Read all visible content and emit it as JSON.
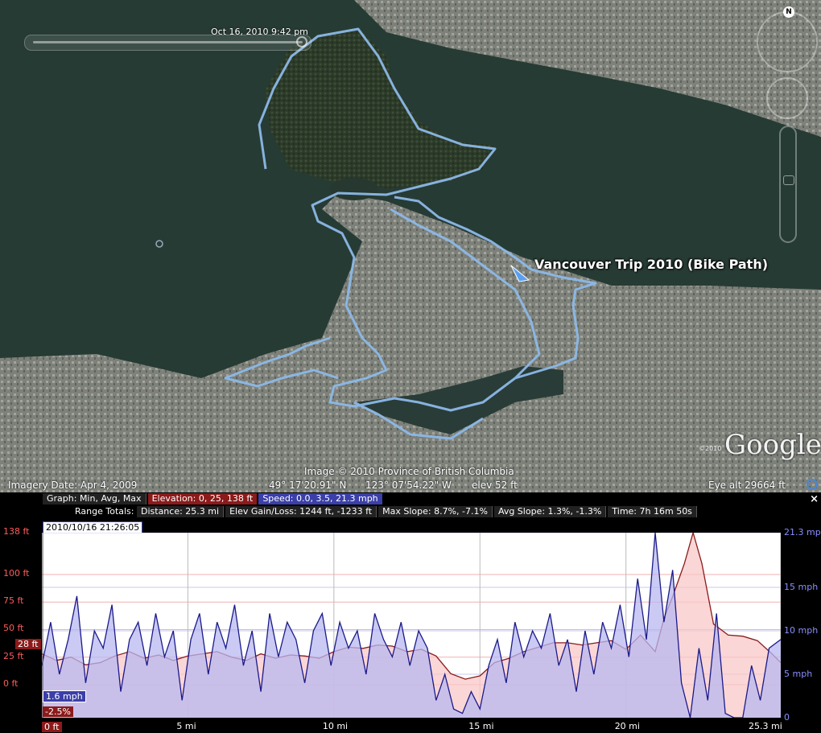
{
  "map": {
    "time_label": "Oct 16, 2010   9:42 pm",
    "placemark_label": "Vancouver Trip 2010 (Bike Path)",
    "attribution": "Image © 2010 Province of British Columbia",
    "logo_text": "Google",
    "logo_copyright": "©2010",
    "compass_label": "N",
    "status": {
      "imagery_date": "Imagery Date: Apr  4, 2009",
      "latitude": "49°  17'20.91\" N",
      "longitude": "123°  07'54.22\" W",
      "elev": "elev    52 ft",
      "eye_alt": "Eye alt    29664 ft"
    },
    "colors": {
      "track": "#8cb8e8",
      "water": "#263a35",
      "land": "#7a7f78"
    }
  },
  "profile": {
    "close_label": "×",
    "graph_label": "Graph: Min, Avg, Max",
    "elevation_stats": "Elevation: 0, 25, 138 ft",
    "speed_stats": "Speed: 0.0, 3.5, 21.3 mph",
    "range_totals_label": "Range Totals:",
    "distance": "Distance: 25.3 mi",
    "elev_gain_loss": "Elev Gain/Loss: 1244 ft, -1233 ft",
    "max_slope": "Max Slope: 8.7%, -7.1%",
    "avg_slope": "Avg Slope: 1.3%, -1.3%",
    "time": "Time: 7h 16m 50s",
    "cursor_date": "2010/10/16 21:26:05",
    "cursor_elev": "28 ft",
    "cursor_speed": "1.6 mph",
    "cursor_slope": "-2.5%",
    "cursor_distance": "0 ft",
    "colors": {
      "elevation": "#8b1a1a",
      "elevation_fill": "#f8c8c8",
      "speed": "#1a1a8a",
      "speed_fill": "#b8b8f0"
    }
  },
  "chart_data": {
    "type": "area",
    "xlabel": "",
    "ylabel_left": "",
    "ylabel_right": "",
    "x_ticks": [
      "5 mi",
      "10 mi",
      "15 mi",
      "20 mi",
      "25.3 mi"
    ],
    "y_left_ticks": [
      "138 ft",
      "100 ft",
      "75 ft",
      "50 ft",
      "25 ft",
      "0 ft"
    ],
    "y_left_tick_values": [
      138,
      100,
      75,
      50,
      25,
      0
    ],
    "y_right_ticks": [
      "21.3 mph",
      "15 mph",
      "10 mph",
      "5 mph",
      "0"
    ],
    "y_right_tick_values": [
      21.3,
      15,
      10,
      5,
      0
    ],
    "xlim": [
      0,
      25.3
    ],
    "ylim_left": [
      -30,
      138
    ],
    "ylim_right": [
      0,
      21.3
    ],
    "series": [
      {
        "name": "Elevation",
        "unit": "ft",
        "x": [
          0,
          0.5,
          1,
          1.5,
          2,
          2.5,
          3,
          3.5,
          4,
          4.5,
          5,
          5.5,
          6,
          6.5,
          7,
          7.5,
          8,
          8.5,
          9,
          9.5,
          10,
          10.5,
          11,
          11.5,
          12,
          12.5,
          13,
          13.5,
          14,
          14.5,
          15,
          15.5,
          16,
          16.5,
          17,
          17.5,
          18,
          18.5,
          19,
          19.5,
          20,
          20.5,
          21,
          21.3,
          21.6,
          22,
          22.3,
          22.6,
          23,
          23.5,
          24,
          24.5,
          25,
          25.3
        ],
        "values": [
          28,
          22,
          25,
          18,
          20,
          26,
          30,
          24,
          27,
          22,
          26,
          28,
          30,
          25,
          22,
          28,
          24,
          27,
          26,
          24,
          30,
          34,
          33,
          36,
          35,
          30,
          32,
          26,
          10,
          5,
          8,
          20,
          24,
          30,
          34,
          38,
          38,
          36,
          38,
          40,
          32,
          45,
          30,
          60,
          80,
          110,
          138,
          110,
          55,
          45,
          44,
          40,
          28,
          20
        ]
      },
      {
        "name": "Speed",
        "unit": "mph",
        "x": [
          0,
          0.3,
          0.6,
          0.9,
          1.2,
          1.5,
          1.8,
          2.1,
          2.4,
          2.7,
          3,
          3.3,
          3.6,
          3.9,
          4.2,
          4.5,
          4.8,
          5.1,
          5.4,
          5.7,
          6,
          6.3,
          6.6,
          6.9,
          7.2,
          7.5,
          7.8,
          8.1,
          8.4,
          8.7,
          9,
          9.3,
          9.6,
          9.9,
          10.2,
          10.5,
          10.8,
          11.1,
          11.4,
          11.7,
          12,
          12.3,
          12.6,
          12.9,
          13.2,
          13.5,
          13.8,
          14.1,
          14.4,
          14.7,
          15,
          15.3,
          15.6,
          15.9,
          16.2,
          16.5,
          16.8,
          17.1,
          17.4,
          17.7,
          18,
          18.3,
          18.6,
          18.9,
          19.2,
          19.5,
          19.8,
          20.1,
          20.4,
          20.7,
          21,
          21.3,
          21.6,
          21.9,
          22.2,
          22.5,
          22.8,
          23.1,
          23.4,
          23.7,
          24,
          24.3,
          24.6,
          24.9,
          25.3
        ],
        "values": [
          6,
          11,
          5,
          9,
          14,
          4,
          10,
          8,
          13,
          3,
          9,
          11,
          6,
          12,
          7,
          10,
          2,
          9,
          12,
          5,
          11,
          8,
          13,
          6,
          10,
          3,
          12,
          7,
          11,
          9,
          4,
          10,
          12,
          6,
          11,
          8,
          10,
          5,
          12,
          9,
          7,
          11,
          6,
          10,
          8,
          2,
          5,
          1,
          0.5,
          3,
          1,
          6,
          9,
          4,
          11,
          7,
          10,
          8,
          12,
          6,
          9,
          3,
          10,
          5,
          11,
          8,
          13,
          7,
          16,
          9,
          21.3,
          11,
          17,
          4,
          0,
          8,
          2,
          12,
          0.5,
          0,
          0,
          6,
          2,
          8,
          9
        ]
      }
    ],
    "grid": true
  }
}
